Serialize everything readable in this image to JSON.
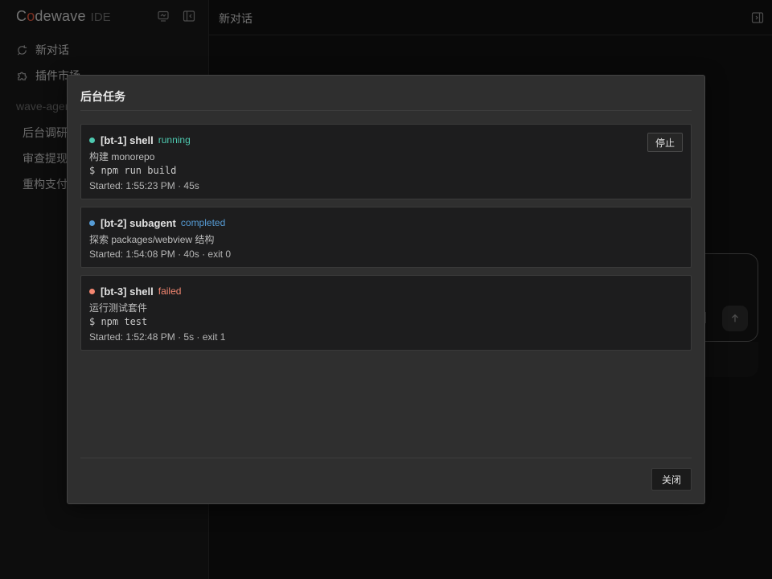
{
  "sidebar": {
    "brand": {
      "name_prefix": "C",
      "name_o": "o",
      "name_suffix": "dewave",
      "suffix": "IDE"
    },
    "nav": [
      {
        "label": "新对话",
        "icon": "new-chat-icon"
      },
      {
        "label": "插件市场",
        "icon": "puzzle-icon"
      }
    ],
    "section_label": "wave-agent",
    "conversations": [
      {
        "label": "后台调研"
      },
      {
        "label": "审查提现"
      },
      {
        "label": "重构支付"
      }
    ]
  },
  "main": {
    "title": "新对话"
  },
  "modal": {
    "title": "后台任务",
    "close_label": "关闭",
    "stop_label": "停止",
    "tasks": [
      {
        "id": "[bt-1] shell",
        "status": "running",
        "status_color": "#4ec9b0",
        "description": "构建 monorepo",
        "command": "$ npm run build",
        "meta": "Started: 1:55:23 PM · 45s"
      },
      {
        "id": "[bt-2] subagent",
        "status": "completed",
        "status_color": "#569cd6",
        "description": "探索 packages/webview 结构",
        "command": "",
        "meta": "Started: 1:54:08 PM · 40s · exit 0"
      },
      {
        "id": "[bt-3] shell",
        "status": "failed",
        "status_color": "#f48771",
        "description": "运行测试套件",
        "command": "$ npm test",
        "meta": "Started: 1:52:48 PM · 5s · exit 1"
      }
    ]
  }
}
